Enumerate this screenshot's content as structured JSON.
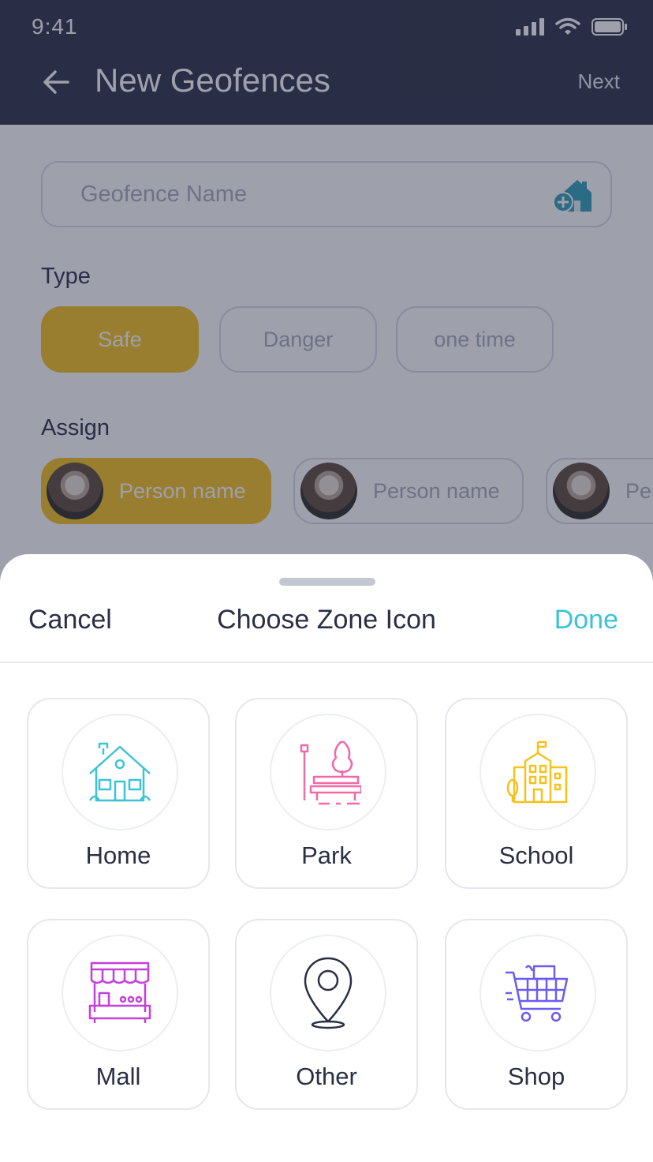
{
  "status_bar": {
    "time": "9:41"
  },
  "header": {
    "title": "New Geofences",
    "next_label": "Next"
  },
  "form": {
    "name_placeholder": "Geofence Name",
    "type_label": "Type",
    "types": [
      {
        "label": "Safe",
        "selected": true
      },
      {
        "label": "Danger",
        "selected": false
      },
      {
        "label": "one time",
        "selected": false
      }
    ],
    "assign_label": "Assign",
    "people": [
      {
        "name": "Person name",
        "selected": true
      },
      {
        "name": "Person name",
        "selected": false
      },
      {
        "name": "Person name",
        "selected": false
      }
    ]
  },
  "sheet": {
    "cancel_label": "Cancel",
    "title": "Choose Zone Icon",
    "done_label": "Done",
    "icons": [
      {
        "label": "Home",
        "icon": "home-icon",
        "color": "#3cc3d6"
      },
      {
        "label": "Park",
        "icon": "park-bench-icon",
        "color": "#f06aa8"
      },
      {
        "label": "School",
        "icon": "school-icon",
        "color": "#f5c11b"
      },
      {
        "label": "Mall",
        "icon": "mall-storefront-icon",
        "color": "#c43fdc"
      },
      {
        "label": "Other",
        "icon": "map-pin-icon",
        "color": "#2b2f45"
      },
      {
        "label": "Shop",
        "icon": "shopping-cart-icon",
        "color": "#6a5cf0"
      }
    ]
  },
  "colors": {
    "header_bg": "#2b2f45",
    "accent_yellow": "#f5c11b",
    "accent_teal": "#3cc3d6"
  }
}
